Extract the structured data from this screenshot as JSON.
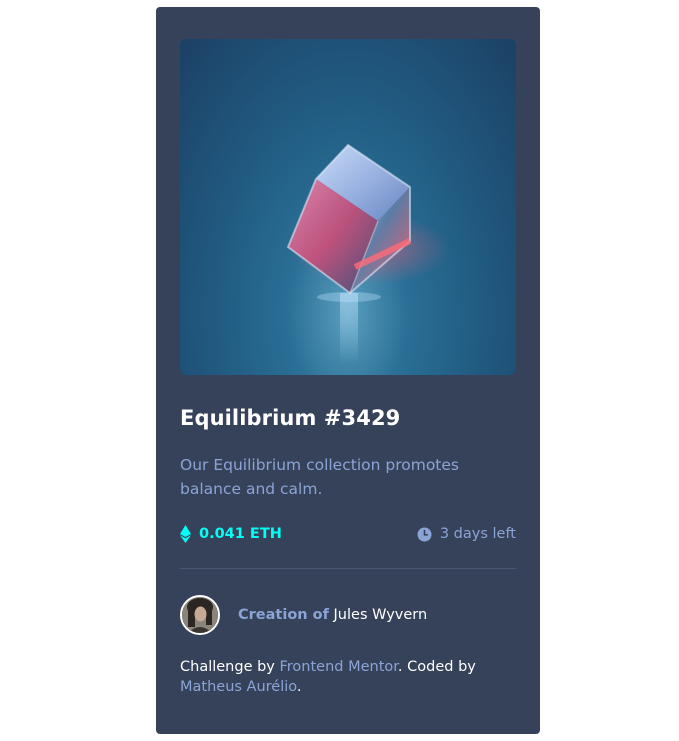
{
  "card": {
    "image_alt": "Equilibrium image",
    "title": "Equilibrium #3429",
    "description": "Our Equilibrium collection promotes balance and calm.",
    "price": "0.041 ETH",
    "time_left": "3 days left"
  },
  "creator": {
    "prefix": "Creation of",
    "name": "Jules Wyvern"
  },
  "attribution": {
    "prefix": "Challenge by ",
    "mentor_link": "Frontend Mentor",
    "middle": ". Coded by ",
    "author_link": "Matheus Aurélio",
    "suffix": "."
  },
  "icons": {
    "price": "ethereum-icon",
    "time": "clock-icon"
  },
  "colors": {
    "card_bg": "#364259",
    "accent_cyan": "#00fff7",
    "soft_blue": "#8ba4d6",
    "white": "#ffffff"
  }
}
